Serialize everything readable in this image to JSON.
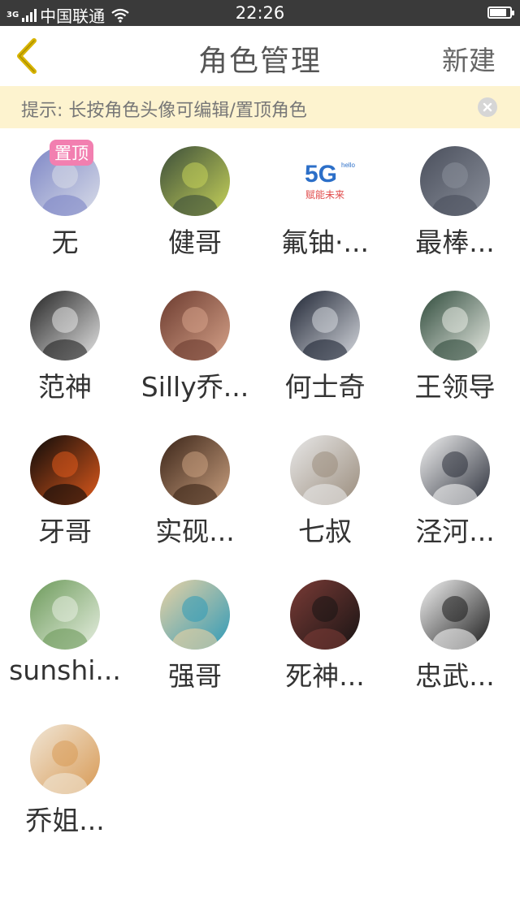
{
  "status_bar": {
    "network_tag": "3G",
    "carrier": "中国联通",
    "time": "22:26",
    "battery_level": 0.85
  },
  "header": {
    "title": "角色管理",
    "new_label": "新建",
    "back_icon": "chevron-left-icon"
  },
  "tip": {
    "text": "提示: 长按角色头像可编辑/置顶角色",
    "close_icon": "close-icon"
  },
  "pin_label": "置顶",
  "characters": [
    {
      "name": "无",
      "pinned": true,
      "colors": [
        "#7d86c6",
        "#d9dde8"
      ]
    },
    {
      "name": "健哥",
      "colors": [
        "#3b4d3a",
        "#c7d35a"
      ]
    },
    {
      "name": "氟铀·...",
      "colors": [
        "#ffffff",
        "#2c6fc8"
      ],
      "logo_text": "5G",
      "logo_sub": "赋能未来",
      "logo_corner": "hello"
    },
    {
      "name": "最棒...",
      "colors": [
        "#4a4f5c",
        "#8a8f9a"
      ]
    },
    {
      "name": "范神",
      "colors": [
        "#222222",
        "#e6e6e6"
      ]
    },
    {
      "name": "Silly乔...",
      "colors": [
        "#6b3a2e",
        "#d7a38a"
      ]
    },
    {
      "name": "何士奇",
      "colors": [
        "#1e2433",
        "#d6d9df"
      ]
    },
    {
      "name": "王领导",
      "colors": [
        "#2e4a3a",
        "#e9ece5"
      ]
    },
    {
      "name": "牙哥",
      "colors": [
        "#0a0a0a",
        "#e05a1c"
      ]
    },
    {
      "name": "实砚...",
      "colors": [
        "#3a2418",
        "#caa07f"
      ]
    },
    {
      "name": "七叔",
      "colors": [
        "#e8e8e8",
        "#9a8c7c"
      ]
    },
    {
      "name": "泾河...",
      "colors": [
        "#f2f2f2",
        "#2b2f3a"
      ]
    },
    {
      "name": "sunshi...",
      "colors": [
        "#6c9a5a",
        "#e7efe1"
      ]
    },
    {
      "name": "强哥",
      "colors": [
        "#e9d2a4",
        "#2f9ab8"
      ]
    },
    {
      "name": "死神...",
      "colors": [
        "#7a3b36",
        "#181414"
      ]
    },
    {
      "name": "忠武...",
      "colors": [
        "#f4f4f4",
        "#1a1a1a"
      ]
    },
    {
      "name": "乔姐...",
      "colors": [
        "#f0e6d6",
        "#d89a55"
      ]
    }
  ]
}
